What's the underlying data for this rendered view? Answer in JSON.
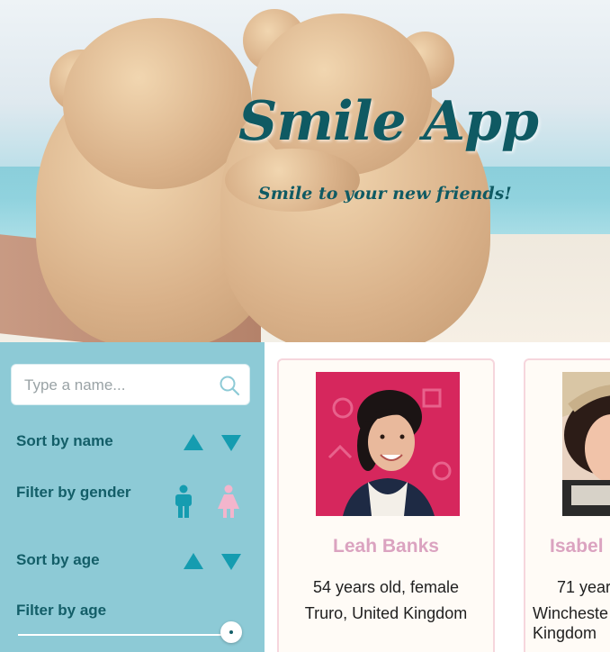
{
  "hero": {
    "title": "Smile App",
    "subtitle": "Smile to your new friends!"
  },
  "sidebar": {
    "search_placeholder": "Type a name...",
    "sort_by_name_label": "Sort by name",
    "filter_by_gender_label": "Filter by gender",
    "sort_by_age_label": "Sort by age",
    "filter_by_age_label": "Filter by age",
    "age_filter_value": 1.0
  },
  "colors": {
    "sidebar_bg": "#8dcad6",
    "accent": "#159cb0",
    "heading": "#135e68",
    "name_pink": "#dba3c0",
    "female_icon": "#f3b5cc"
  },
  "cards": [
    {
      "name": "Leah Banks",
      "line1": "54 years old, female",
      "line2": "Truro, United Kingdom"
    },
    {
      "name": "Isabel",
      "line1": "71 year",
      "line2": "Wincheste",
      "line3": "Kingdom"
    }
  ]
}
